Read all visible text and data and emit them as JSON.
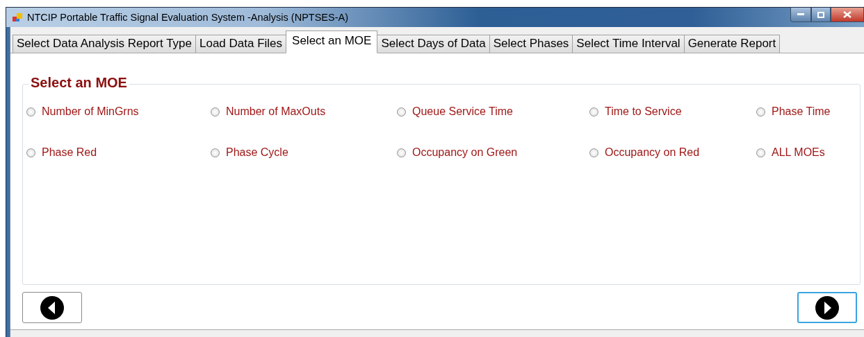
{
  "window": {
    "title": "NTCIP Portable Traffic Signal Evaluation System -Analysis (NPTSES-A)"
  },
  "tabs": [
    {
      "label": "Select Data Analysis Report Type",
      "selected": false
    },
    {
      "label": "Load Data Files",
      "selected": false
    },
    {
      "label": "Select an MOE",
      "selected": true
    },
    {
      "label": "Select Days of Data",
      "selected": false
    },
    {
      "label": "Select Phases",
      "selected": false
    },
    {
      "label": "Select Time Interval",
      "selected": false
    },
    {
      "label": "Generate Report",
      "selected": false
    }
  ],
  "group": {
    "title": "Select an MOE",
    "options": [
      {
        "label": "Number of MinGrns",
        "selected": false
      },
      {
        "label": "Number of MaxOuts",
        "selected": false
      },
      {
        "label": "Queue Service Time",
        "selected": false
      },
      {
        "label": "Time to Service",
        "selected": false
      },
      {
        "label": "Phase Time",
        "selected": false
      },
      {
        "label": "Phase Red",
        "selected": false
      },
      {
        "label": "Phase Cycle",
        "selected": false
      },
      {
        "label": "Occupancy on Green",
        "selected": false
      },
      {
        "label": "Occupancy on Red",
        "selected": false
      },
      {
        "label": "ALL MOEs",
        "selected": false
      }
    ]
  },
  "nav": [
    {
      "kind": "back",
      "focused": false
    },
    {
      "kind": "next",
      "focused": true
    }
  ]
}
